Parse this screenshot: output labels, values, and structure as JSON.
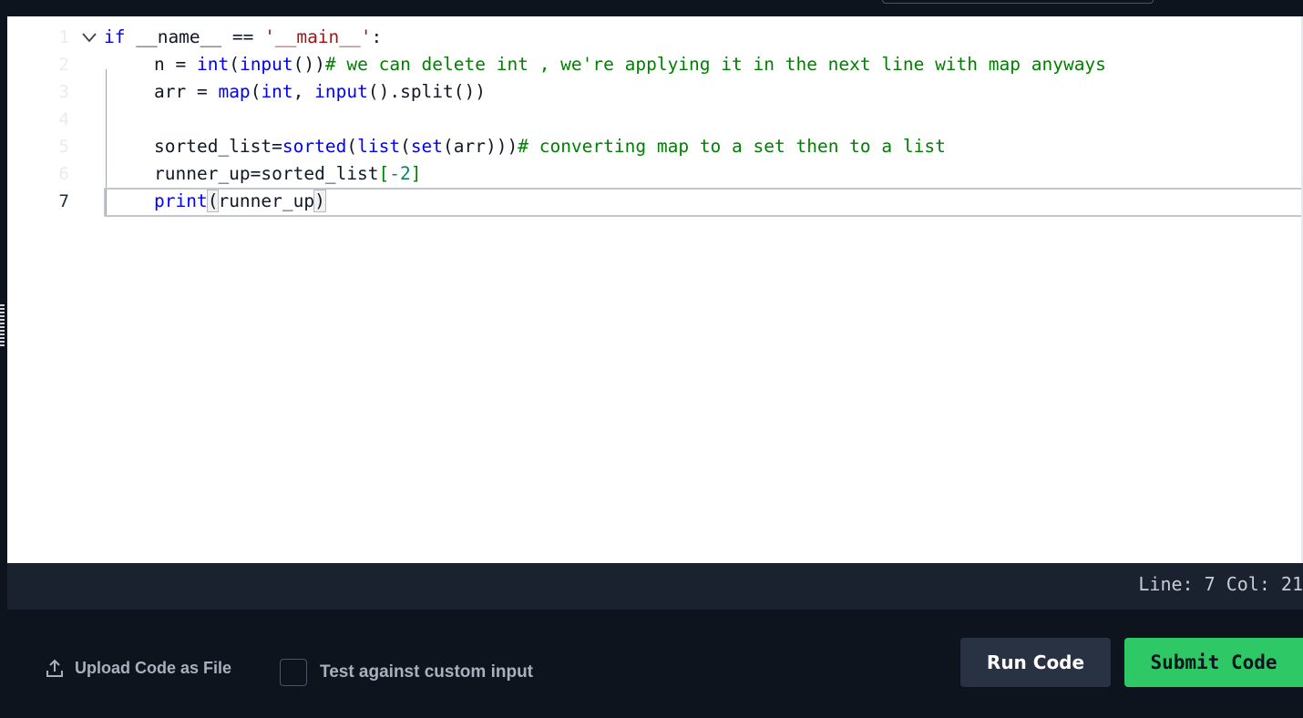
{
  "editor": {
    "current_line": "7",
    "lines": [
      {
        "number": "1"
      },
      {
        "number": "2"
      },
      {
        "number": "3"
      },
      {
        "number": "4"
      },
      {
        "number": "5"
      },
      {
        "number": "6"
      },
      {
        "number": "7"
      }
    ],
    "code": {
      "l1_kw": "if",
      "l1_rest": " __name__ == ",
      "l1_str": "'__main__'",
      "l1_colon": ":",
      "l2_a": "n = ",
      "l2_int": "int",
      "l2_p1": "(",
      "l2_input": "input",
      "l2_p2": "())",
      "l2_comment": "# we can delete int , we're applying it in the next line with map anyways",
      "l3_a": "arr = ",
      "l3_map": "map",
      "l3_p1": "(",
      "l3_int": "int",
      "l3_p2": ", ",
      "l3_input": "input",
      "l3_p3": "().split())",
      "l5_a": "sorted_list=",
      "l5_sorted": "sorted",
      "l5_p1": "(",
      "l5_list": "list",
      "l5_p2": "(",
      "l5_set": "set",
      "l5_p3": "(arr)))",
      "l5_comment": "# converting map to a set then to a list",
      "l6_a": "runner_up=sorted_list",
      "l6_br1": "[",
      "l6_num": "-2",
      "l6_br2": "]",
      "l7_print": "print",
      "l7_p1": "(",
      "l7_arg": "runner_up",
      "l7_p2": ")"
    }
  },
  "status": {
    "position": "Line: 7 Col: 21"
  },
  "footer": {
    "upload_label": "Upload Code as File",
    "custom_input_label": "Test against custom input",
    "run_label": "Run Code",
    "submit_label": "Submit Code"
  },
  "colors": {
    "keyword": "#0000ff",
    "string": "#a31515",
    "comment": "#008000",
    "number": "#098658",
    "submit": "#2ec866",
    "run": "#283243"
  },
  "icons": {
    "fold": "chevron-down-icon",
    "upload": "upload-icon"
  }
}
